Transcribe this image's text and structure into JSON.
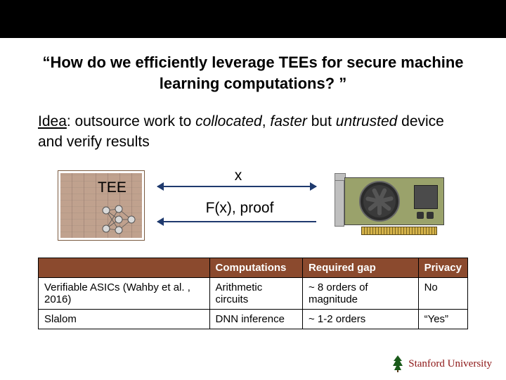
{
  "title": "“How do we efficiently leverage TEEs for secure machine learning computations? ”",
  "idea": {
    "prefix_underlined": "Idea",
    "mid1": ": outsource work to ",
    "it1": "collocated",
    "mid2": ", ",
    "it2": "faster",
    "mid3": " but ",
    "it3": "untrusted",
    "mid4": " device and verify results"
  },
  "diagram": {
    "tee_label": "TEE",
    "x_label": "x",
    "fx_label": "F(x), proof"
  },
  "table": {
    "headers": {
      "c1": "",
      "c2": "Computations",
      "c3": "Required gap",
      "c4": "Privacy"
    },
    "rows": [
      {
        "c1": "Verifiable ASICs (Wahby et al. , 2016)",
        "c2": "Arithmetic circuits",
        "c3": "~ 8 orders of magnitude",
        "c4": "No"
      },
      {
        "c1": "Slalom",
        "c2": "DNN inference",
        "c3": "~ 1-2 orders",
        "c4": "“Yes”"
      }
    ]
  },
  "logo_text": "Stanford University"
}
